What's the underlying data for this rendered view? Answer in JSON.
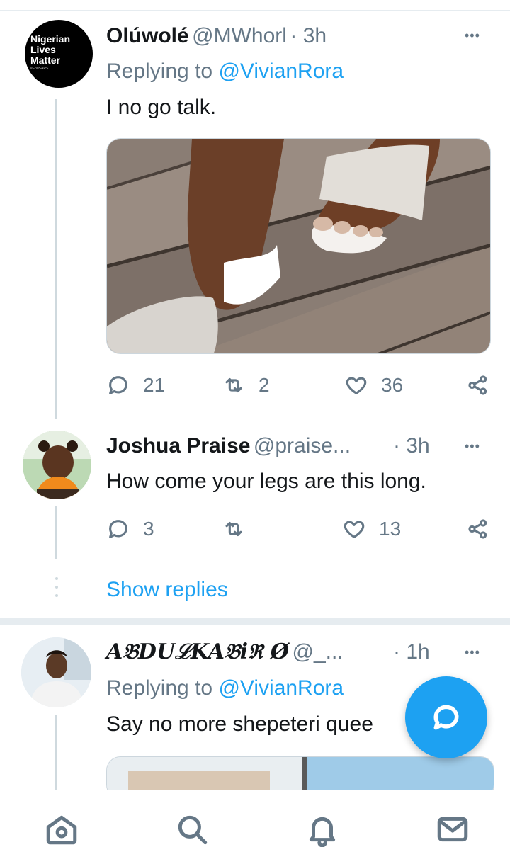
{
  "tweets": [
    {
      "name": "Olúwolé",
      "handle": "@MWhorl",
      "time": "· 3h",
      "replying_prefix": "Replying to ",
      "replying_to": "@VivianRora",
      "text": "I no go talk.",
      "avatar_text": [
        "Nigerian",
        "Lives",
        "Matter"
      ],
      "avatar_small": "#EndSARS",
      "replies": "21",
      "retweets": "2",
      "likes": "36"
    },
    {
      "name": "Joshua Praise",
      "handle": "@praise...",
      "time": "· 3h",
      "text": "How come your legs are this long.",
      "replies": "3",
      "retweets": "",
      "likes": "13"
    },
    {
      "name": "A𝔅DUℒKA𝔅iℜ Ø",
      "handle": "@_...",
      "time": "· 1h",
      "replying_prefix": "Replying to ",
      "replying_to": "@VivianRora",
      "text": "Say no more shepeteri quee"
    }
  ],
  "show_replies": "Show replies",
  "more_label": "•••",
  "icons": {
    "reply": "reply-icon",
    "retweet": "retweet-icon",
    "like": "heart-icon",
    "share": "share-icon",
    "compose": "compose-reply-icon",
    "nav": [
      "home-icon",
      "search-icon",
      "notifications-icon",
      "messages-icon"
    ]
  },
  "colors": {
    "accent": "#1da1f2",
    "secondary_text": "#657786",
    "divider": "#e6ecf0"
  }
}
